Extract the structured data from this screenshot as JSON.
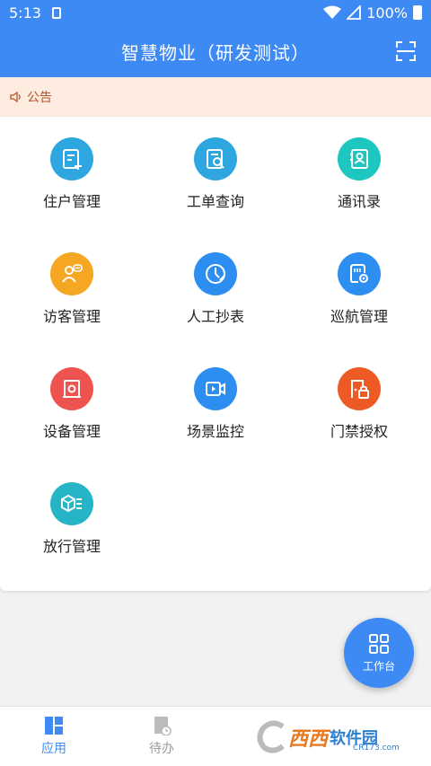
{
  "status_bar": {
    "time": "5:13",
    "battery": "100%"
  },
  "app_bar": {
    "title": "智慧物业（研发测试）"
  },
  "notice": {
    "label": "公告"
  },
  "grid": [
    {
      "label": "住户管理",
      "icon": "resident-doc-add-icon",
      "color": "#2ea7e0"
    },
    {
      "label": "工单查询",
      "icon": "work-order-search-icon",
      "color": "#2ea7e0"
    },
    {
      "label": "通讯录",
      "icon": "contacts-icon",
      "color": "#1ec6c0"
    },
    {
      "label": "访客管理",
      "icon": "visitor-icon",
      "color": "#f5a623"
    },
    {
      "label": "人工抄表",
      "icon": "meter-icon",
      "color": "#2b8ef0"
    },
    {
      "label": "巡航管理",
      "icon": "patrol-icon",
      "color": "#2b8ef0"
    },
    {
      "label": "设备管理",
      "icon": "device-icon",
      "color": "#ef5350"
    },
    {
      "label": "场景监控",
      "icon": "video-monitor-icon",
      "color": "#2b8ef0"
    },
    {
      "label": "门禁授权",
      "icon": "access-lock-icon",
      "color": "#ee5a24"
    },
    {
      "label": "放行管理",
      "icon": "release-box-icon",
      "color": "#26b5c6"
    }
  ],
  "fab": {
    "label": "工作台"
  },
  "bottom_nav": [
    {
      "label": "应用",
      "active": true
    },
    {
      "label": "待办",
      "active": false
    }
  ],
  "watermark": {
    "brand": "西西",
    "suffix": "软件园",
    "site": "CR173.com"
  }
}
